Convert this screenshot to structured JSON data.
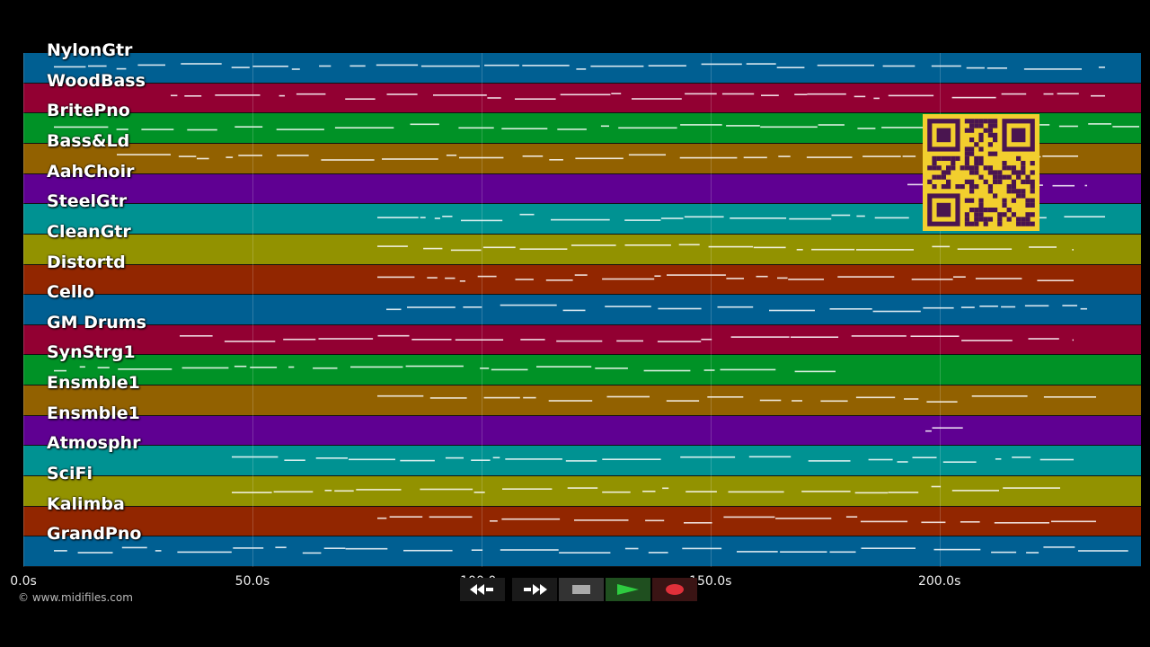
{
  "tracks": [
    {
      "name": "NylonGtr",
      "color": "#005f92"
    },
    {
      "name": "WoodBass",
      "color": "#920032"
    },
    {
      "name": "BritePno",
      "color": "#009226"
    },
    {
      "name": "Bass&Ld",
      "color": "#926100"
    },
    {
      "name": "AahChoir",
      "color": "#5f0092"
    },
    {
      "name": "SteelGtr",
      "color": "#009292"
    },
    {
      "name": "CleanGtr",
      "color": "#929200"
    },
    {
      "name": "Distortd",
      "color": "#922600"
    },
    {
      "name": "Cello",
      "color": "#005f92"
    },
    {
      "name": "GM Drums",
      "color": "#920032"
    },
    {
      "name": "SynStrg1",
      "color": "#009226"
    },
    {
      "name": "Ensmble1",
      "color": "#926100"
    },
    {
      "name": "Ensmble1",
      "color": "#5f0092"
    },
    {
      "name": "Atmosphr",
      "color": "#009292"
    },
    {
      "name": "SciFi",
      "color": "#929200"
    },
    {
      "name": "Kalimba",
      "color": "#922600"
    },
    {
      "name": "GrandPno",
      "color": "#005f92"
    }
  ],
  "timeline": {
    "seconds_visible": 244,
    "ticks": [
      {
        "label": "0.0s",
        "seconds": 0
      },
      {
        "label": "50.0s",
        "seconds": 50
      },
      {
        "label": "100.0s",
        "seconds": 100
      },
      {
        "label": "150.0s",
        "seconds": 150
      },
      {
        "label": "200.0s",
        "seconds": 200
      }
    ]
  },
  "copyright": "© www.midifiles.com",
  "transport": {
    "rewind": "rewind-icon",
    "fast_forward": "fast-forward-icon",
    "stop": "stop-icon",
    "play": "play-icon",
    "record": "record-icon",
    "play_color": "#2ecc40",
    "record_color": "#e0303a"
  },
  "qr_code": {
    "color": "#f2cf2e",
    "module_color": "#4a1550"
  }
}
